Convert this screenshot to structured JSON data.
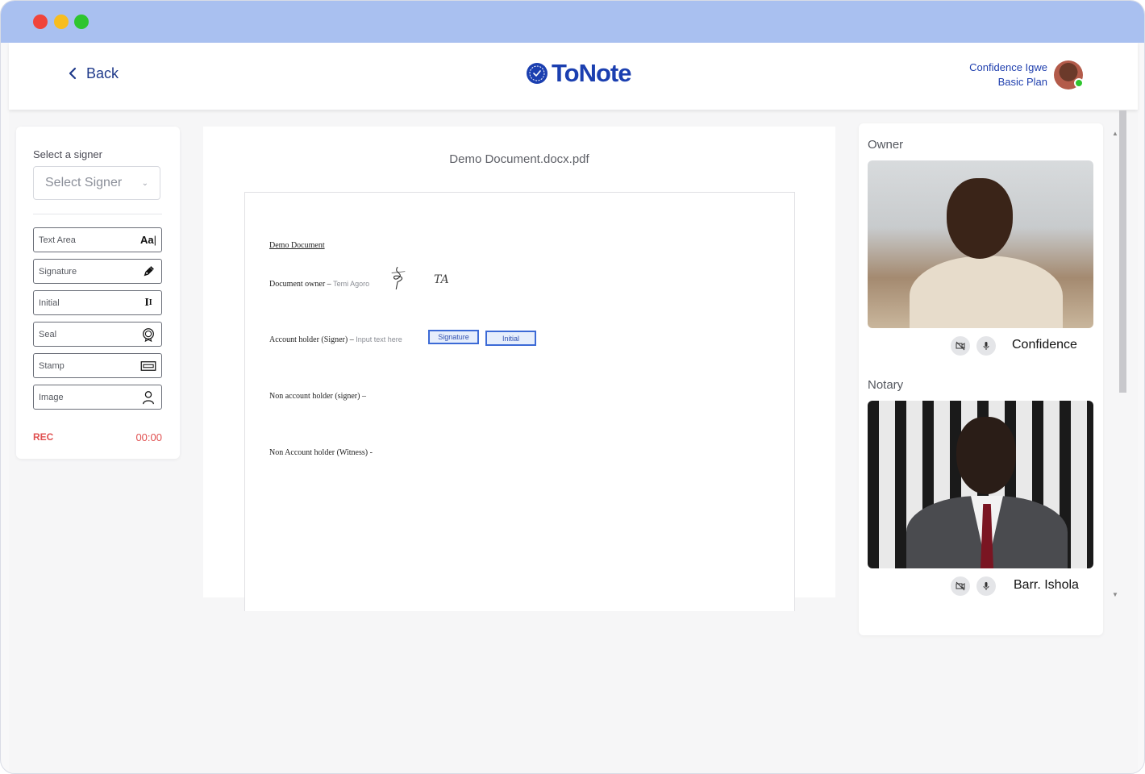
{
  "header": {
    "back_label": "Back",
    "logo_text": "ToNote",
    "user_name": "Confidence Igwe",
    "user_plan": "Basic Plan"
  },
  "tools": {
    "select_label": "Select a signer",
    "select_placeholder": "Select Signer",
    "items": [
      {
        "label": "Text Area",
        "icon": "text-area-icon"
      },
      {
        "label": "Signature",
        "icon": "pen-icon"
      },
      {
        "label": "Initial",
        "icon": "initial-icon"
      },
      {
        "label": "Seal",
        "icon": "seal-icon"
      },
      {
        "label": "Stamp",
        "icon": "stamp-icon"
      },
      {
        "label": "Image",
        "icon": "user-icon"
      }
    ],
    "rec_label": "REC",
    "timer": "00:00"
  },
  "document": {
    "filename": "Demo Document.docx.pdf",
    "heading": "Demo Document",
    "owner_line": "Document owner – ",
    "owner_name": "Temi Agoro",
    "owner_initials": "TA",
    "account_holder_line": "Account holder (Signer) – ",
    "account_holder_placeholder": "Input text here",
    "signature_box": "Signature",
    "initial_box": "Initial",
    "non_account_signer": "Non account holder (signer) –",
    "non_account_witness": "Non Account holder (Witness) -"
  },
  "call": {
    "owner_role": "Owner",
    "owner_name": "Confidence",
    "notary_role": "Notary",
    "notary_name": "Barr. Ishola"
  },
  "colors": {
    "brand": "#1b3fb0",
    "titlebar": "#a9c0f0",
    "rec": "#e05050",
    "field_border": "#3c6ad6"
  }
}
